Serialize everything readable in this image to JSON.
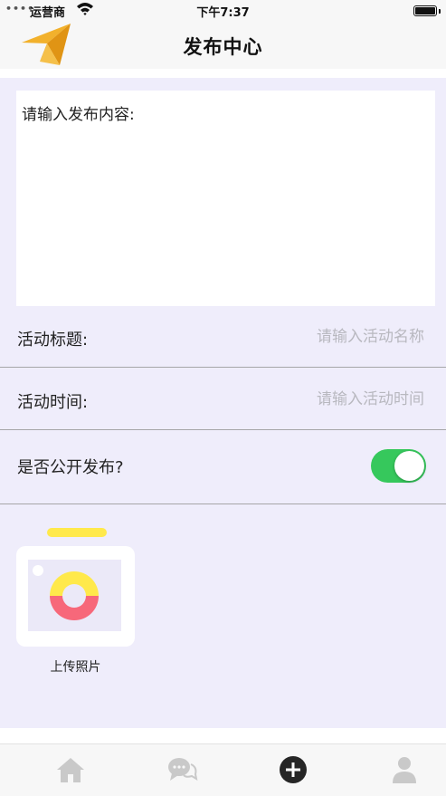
{
  "status_bar": {
    "signal": "••••",
    "carrier": "运营商",
    "time": "下午7:37"
  },
  "header": {
    "title": "发布中心",
    "logo_icon": "paper-plane-icon",
    "logo_color": "#eba21c"
  },
  "form": {
    "content_placeholder": "请输入发布内容:",
    "title_label": "活动标题:",
    "title_placeholder": "请输入活动名称",
    "time_label": "活动时间:",
    "time_placeholder": "请输入活动时间",
    "public_label": "是否公开发布?",
    "public_enabled": true,
    "toggle_color": "#36c85c",
    "upload_label": "上传照片"
  },
  "tab_bar": {
    "items": [
      {
        "icon": "home-icon",
        "active": false
      },
      {
        "icon": "chat-icon",
        "active": false
      },
      {
        "icon": "add-circle-icon",
        "active": true
      },
      {
        "icon": "user-icon",
        "active": false
      }
    ]
  },
  "colors": {
    "background": "#efedfb",
    "upload_accent_yellow": "#ffe94b",
    "upload_accent_red": "#f7687a"
  }
}
